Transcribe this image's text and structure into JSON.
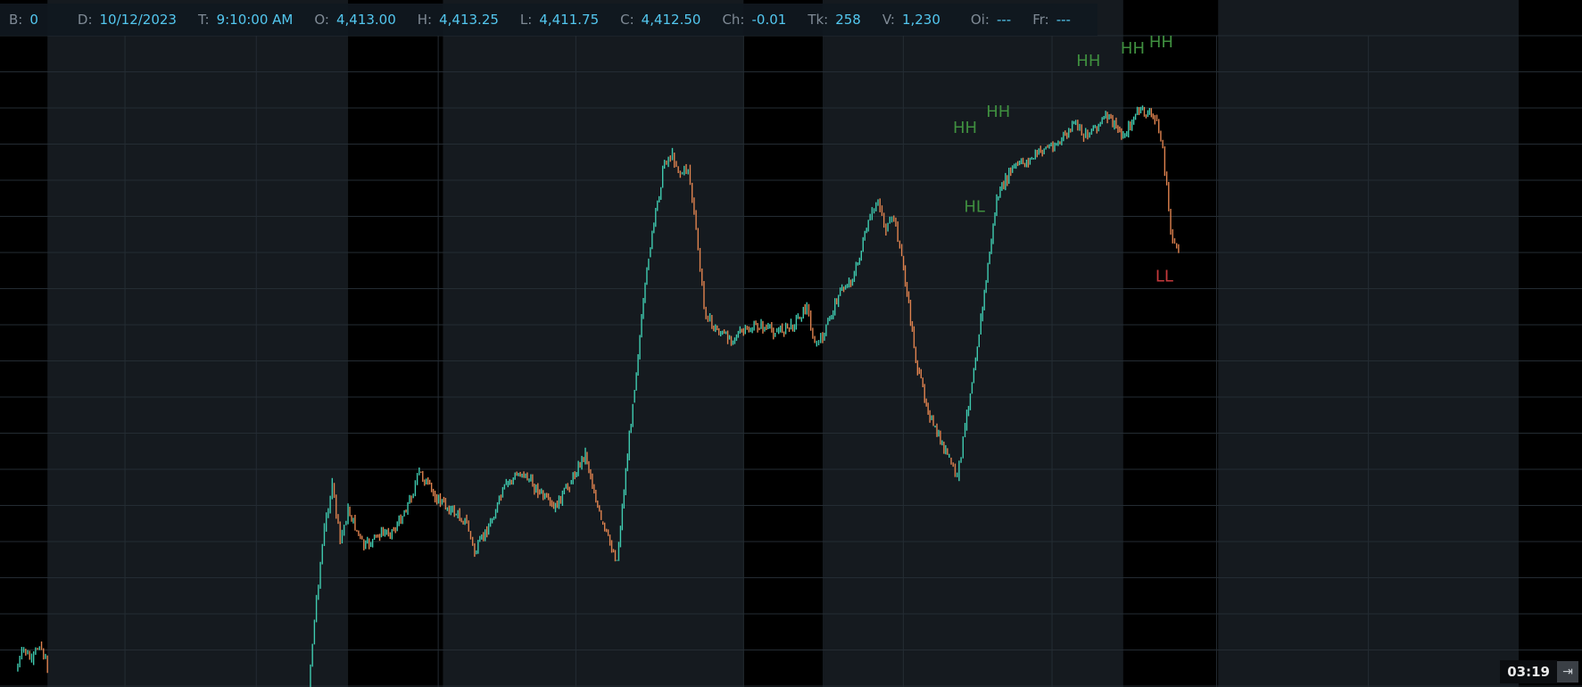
{
  "info": {
    "b_label": "B:",
    "b": "0",
    "d_label": "D:",
    "d": "10/12/2023",
    "t_label": "T:",
    "t": "9:10:00 AM",
    "o_label": "O:",
    "o": "4,413.00",
    "h_label": "H:",
    "h": "4,413.25",
    "l_label": "L:",
    "l": "4,411.75",
    "c_label": "C:",
    "c": "4,412.50",
    "ch_label": "Ch:",
    "ch": "-0.01",
    "tk_label": "Tk:",
    "tk": "258",
    "v_label": "V:",
    "v": "1,230",
    "oi_label": "Oi:",
    "oi": "---",
    "fr_label": "Fr:",
    "fr": "---"
  },
  "timer": "03:19",
  "colors": {
    "up": "#3fcbb0",
    "down": "#e0834f",
    "hh": "#3f8f3f",
    "ll": "#c5393b",
    "session_bg": "#151a1f",
    "night_bg": "#000000",
    "grid": "#242c33"
  },
  "chart_data": {
    "type": "line",
    "title": "",
    "xlabel": "",
    "ylabel": "",
    "ylim": [
      0,
      100
    ],
    "session_shading": [
      {
        "start": 3,
        "end": 22
      },
      {
        "start": 28,
        "end": 47
      },
      {
        "start": 52,
        "end": 71
      },
      {
        "start": 77,
        "end": 96
      }
    ],
    "series": [
      {
        "values": [
          [
            1,
            2.5
          ],
          [
            1.5,
            6
          ],
          [
            2,
            4
          ],
          [
            2.5,
            7
          ],
          [
            3,
            3
          ],
          [
            19.5,
            0
          ],
          [
            20,
            14
          ],
          [
            20.5,
            25
          ],
          [
            21,
            32
          ],
          [
            21.5,
            23
          ],
          [
            22,
            28
          ],
          [
            23,
            22
          ],
          [
            24,
            24
          ],
          [
            25,
            25
          ],
          [
            26,
            30
          ],
          [
            26.5,
            34
          ],
          [
            27.5,
            30
          ],
          [
            28.5,
            28
          ],
          [
            29.5,
            26
          ],
          [
            30,
            21
          ],
          [
            31,
            26
          ],
          [
            32,
            32
          ],
          [
            33,
            34
          ],
          [
            34,
            31
          ],
          [
            35,
            28
          ],
          [
            36,
            32
          ],
          [
            37,
            37
          ],
          [
            38,
            26
          ],
          [
            39,
            20
          ],
          [
            40,
            45
          ],
          [
            41,
            68
          ],
          [
            42,
            83
          ],
          [
            42.5,
            84
          ],
          [
            43,
            81
          ],
          [
            43.5,
            82
          ],
          [
            44,
            72
          ],
          [
            44.5,
            60
          ],
          [
            45,
            57
          ],
          [
            46,
            55
          ],
          [
            47,
            56
          ],
          [
            48,
            57
          ],
          [
            49,
            56
          ],
          [
            50,
            57
          ],
          [
            51,
            60
          ],
          [
            51.5,
            54
          ],
          [
            52,
            55
          ],
          [
            53,
            62
          ],
          [
            54,
            65
          ],
          [
            55,
            74
          ],
          [
            55.5,
            77
          ],
          [
            56,
            72
          ],
          [
            56.5,
            74
          ],
          [
            57,
            68
          ],
          [
            58,
            50
          ],
          [
            59,
            41
          ],
          [
            60,
            36
          ],
          [
            60.5,
            33
          ],
          [
            61,
            41
          ],
          [
            62,
            58
          ],
          [
            63,
            77
          ],
          [
            64,
            82
          ],
          [
            65,
            83
          ],
          [
            66,
            85
          ],
          [
            67,
            86
          ],
          [
            68,
            89
          ],
          [
            68.5,
            87
          ],
          [
            69,
            88
          ],
          [
            70,
            90
          ],
          [
            71,
            87
          ],
          [
            72,
            91
          ],
          [
            73,
            90
          ],
          [
            73.5,
            85
          ],
          [
            74,
            72
          ],
          [
            74.5,
            68
          ]
        ]
      }
    ],
    "annotations": [
      {
        "text": "HH",
        "x": 61,
        "y": 87.5,
        "type": "hh"
      },
      {
        "text": "HL",
        "x": 61.6,
        "y": 75,
        "type": "hh"
      },
      {
        "text": "HH",
        "x": 63.1,
        "y": 90,
        "type": "hh"
      },
      {
        "text": "HH",
        "x": 68.8,
        "y": 98,
        "type": "hh"
      },
      {
        "text": "HH",
        "x": 71.6,
        "y": 100,
        "type": "hh"
      },
      {
        "text": "HH",
        "x": 73.4,
        "y": 101,
        "type": "hh"
      },
      {
        "text": "LL",
        "x": 73.6,
        "y": 64,
        "type": "ll"
      }
    ]
  }
}
